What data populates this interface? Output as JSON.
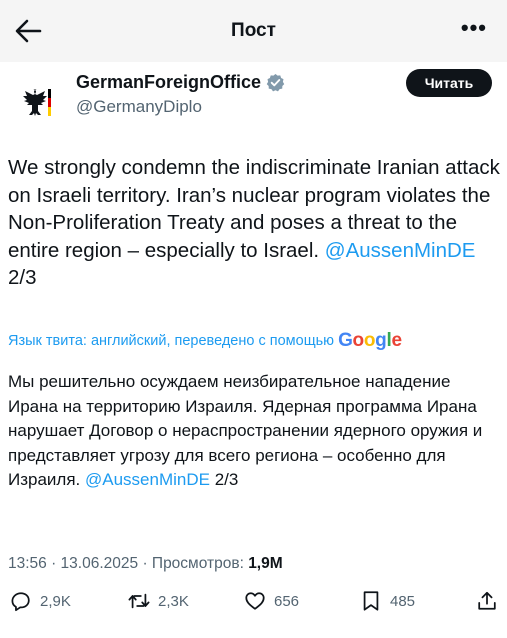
{
  "header": {
    "title": "Пост"
  },
  "author": {
    "name": "GermanForeignOffice",
    "handle": "@GermanyDiplo",
    "follow_label": "Читать"
  },
  "tweet": {
    "text_before_mention": "We strongly condemn the indiscriminate Iranian attack on Israeli territory. Iran’s nuclear program violates the Non-Proliferation Treaty and poses a threat to the entire region – especially to Israel. ",
    "mention": "@AussenMinDE",
    "text_after_mention": " 2/3"
  },
  "translation": {
    "note": "Язык твита: английский, переведено с помощью",
    "provider": "Google",
    "text_before_mention": "Мы решительно осуждаем неизбирательное нападение Ирана на территорию Израиля. Ядерная программа Ирана нарушает Договор о нераспространении ядерного оружия и представляет угрозу для всего региона – особенно для Израиля. ",
    "mention": "@AussenMinDE",
    "text_after_mention": " 2/3"
  },
  "meta": {
    "timestamp": "13:56 · 13.06.2025 · ",
    "views_label": "Просмотров: ",
    "views_count": "1,9M"
  },
  "actions": {
    "replies": "2,9K",
    "reposts": "2,3K",
    "likes": "656",
    "bookmarks": "485"
  },
  "colors": {
    "accent": "#1d9bf0",
    "text": "#0f1419",
    "muted": "#536471"
  },
  "icons": [
    "back-arrow-icon",
    "more-icon",
    "verified-badge-icon",
    "reply-icon",
    "repost-icon",
    "like-icon",
    "bookmark-icon",
    "share-icon"
  ]
}
